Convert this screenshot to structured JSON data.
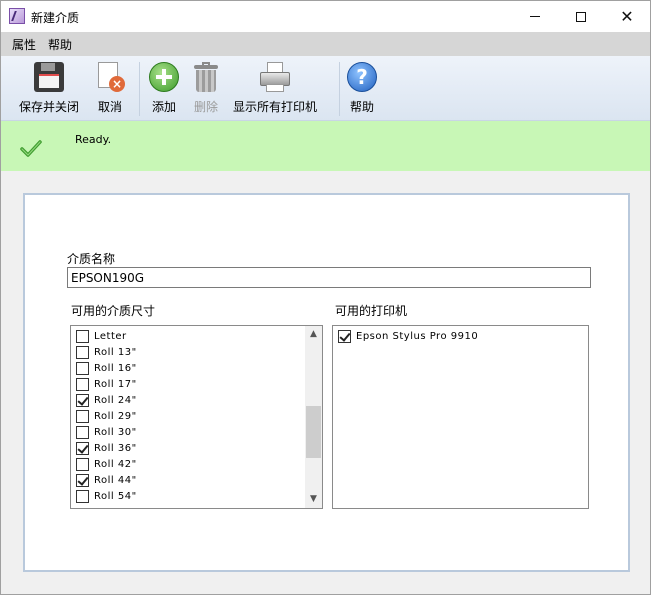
{
  "window": {
    "title": "新建介质",
    "minimize_icon": "minimize-icon",
    "maximize_icon": "maximize-icon",
    "close_icon": "close-icon"
  },
  "menu": {
    "items": [
      "属性",
      "帮助"
    ]
  },
  "toolbar": {
    "save_close_label": "保存并关闭",
    "cancel_label": "取消",
    "add_label": "添加",
    "delete_label": "删除",
    "show_printers_label": "显示所有打印机",
    "help_label": "帮助"
  },
  "status": {
    "text": "Ready.",
    "icon": "checkmark-icon",
    "color": "#c8f7b6"
  },
  "form": {
    "media_name_label": "介质名称",
    "media_name_value": "EPSON190G",
    "sizes_label": "可用的介质尺寸",
    "printers_label": "可用的打印机",
    "sizes": [
      {
        "label": "Letter",
        "checked": false
      },
      {
        "label": "Roll 13\"",
        "checked": false
      },
      {
        "label": "Roll 16\"",
        "checked": false
      },
      {
        "label": "Roll 17\"",
        "checked": false
      },
      {
        "label": "Roll 24\"",
        "checked": true
      },
      {
        "label": "Roll 29\"",
        "checked": false
      },
      {
        "label": "Roll 30\"",
        "checked": false
      },
      {
        "label": "Roll 36\"",
        "checked": true
      },
      {
        "label": "Roll 42\"",
        "checked": false
      },
      {
        "label": "Roll 44\"",
        "checked": true
      },
      {
        "label": "Roll 54\"",
        "checked": false
      }
    ],
    "printers": [
      {
        "label": "Epson Stylus Pro 9910",
        "checked": true
      }
    ]
  }
}
